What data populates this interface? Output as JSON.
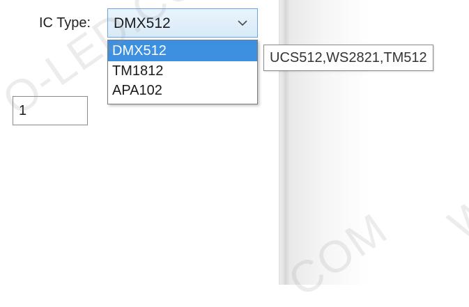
{
  "ic_type": {
    "label": "IC Type:",
    "selected_value": "DMX512",
    "options": [
      "DMX512",
      "TM1812",
      "APA102"
    ],
    "highlighted_index": 0
  },
  "tooltip": {
    "text": "UCS512,WS2821,TM512"
  },
  "numeric_field": {
    "value": "1"
  },
  "watermark": {
    "texts": [
      "O-LED.COM",
      "COM",
      "W"
    ]
  },
  "colors": {
    "selection_blue": "#3d8fe0",
    "select_border": "#6aa6de"
  }
}
